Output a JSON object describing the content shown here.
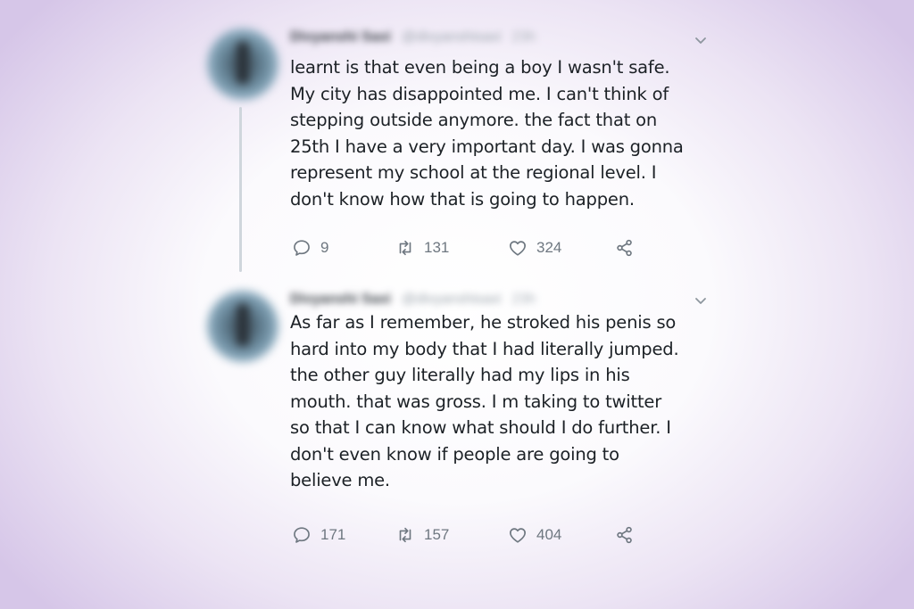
{
  "tweets": [
    {
      "author_name": "Divyanshi Saxi",
      "author_handle": "@divyanshisaxi",
      "timestamp": "23h",
      "text": "learnt is that even being a boy I wasn't safe.\nMy city has disappointed me. I can't think of\nstepping outside anymore. the fact that on\n25th I have a very important day. I was gonna\nrepresent my school at the regional level. I\ndon't know how that is going to happen.",
      "replies": "9",
      "retweets": "131",
      "likes": "324"
    },
    {
      "author_name": "Divyanshi Saxi",
      "author_handle": "@divyanshisaxi",
      "timestamp": "23h",
      "text": "As far as I remember, he stroked his penis so\nhard into my body that I had literally jumped.\nthe other guy literally had my lips in his\nmouth. that was gross. I m taking to twitter\nso that I can know what should I do further. I\ndon't even know if people are going to\nbelieve me.",
      "replies": "171",
      "retweets": "157",
      "likes": "404"
    }
  ],
  "icons": {
    "reply": "reply-icon",
    "retweet": "retweet-icon",
    "like": "heart-icon",
    "share": "share-icon",
    "menu": "chevron-down-icon"
  },
  "colors": {
    "text": "#1c2126",
    "icon": "#6e7780",
    "thread_line": "#cfd6dc",
    "background_edge": "#d6c6e8"
  }
}
